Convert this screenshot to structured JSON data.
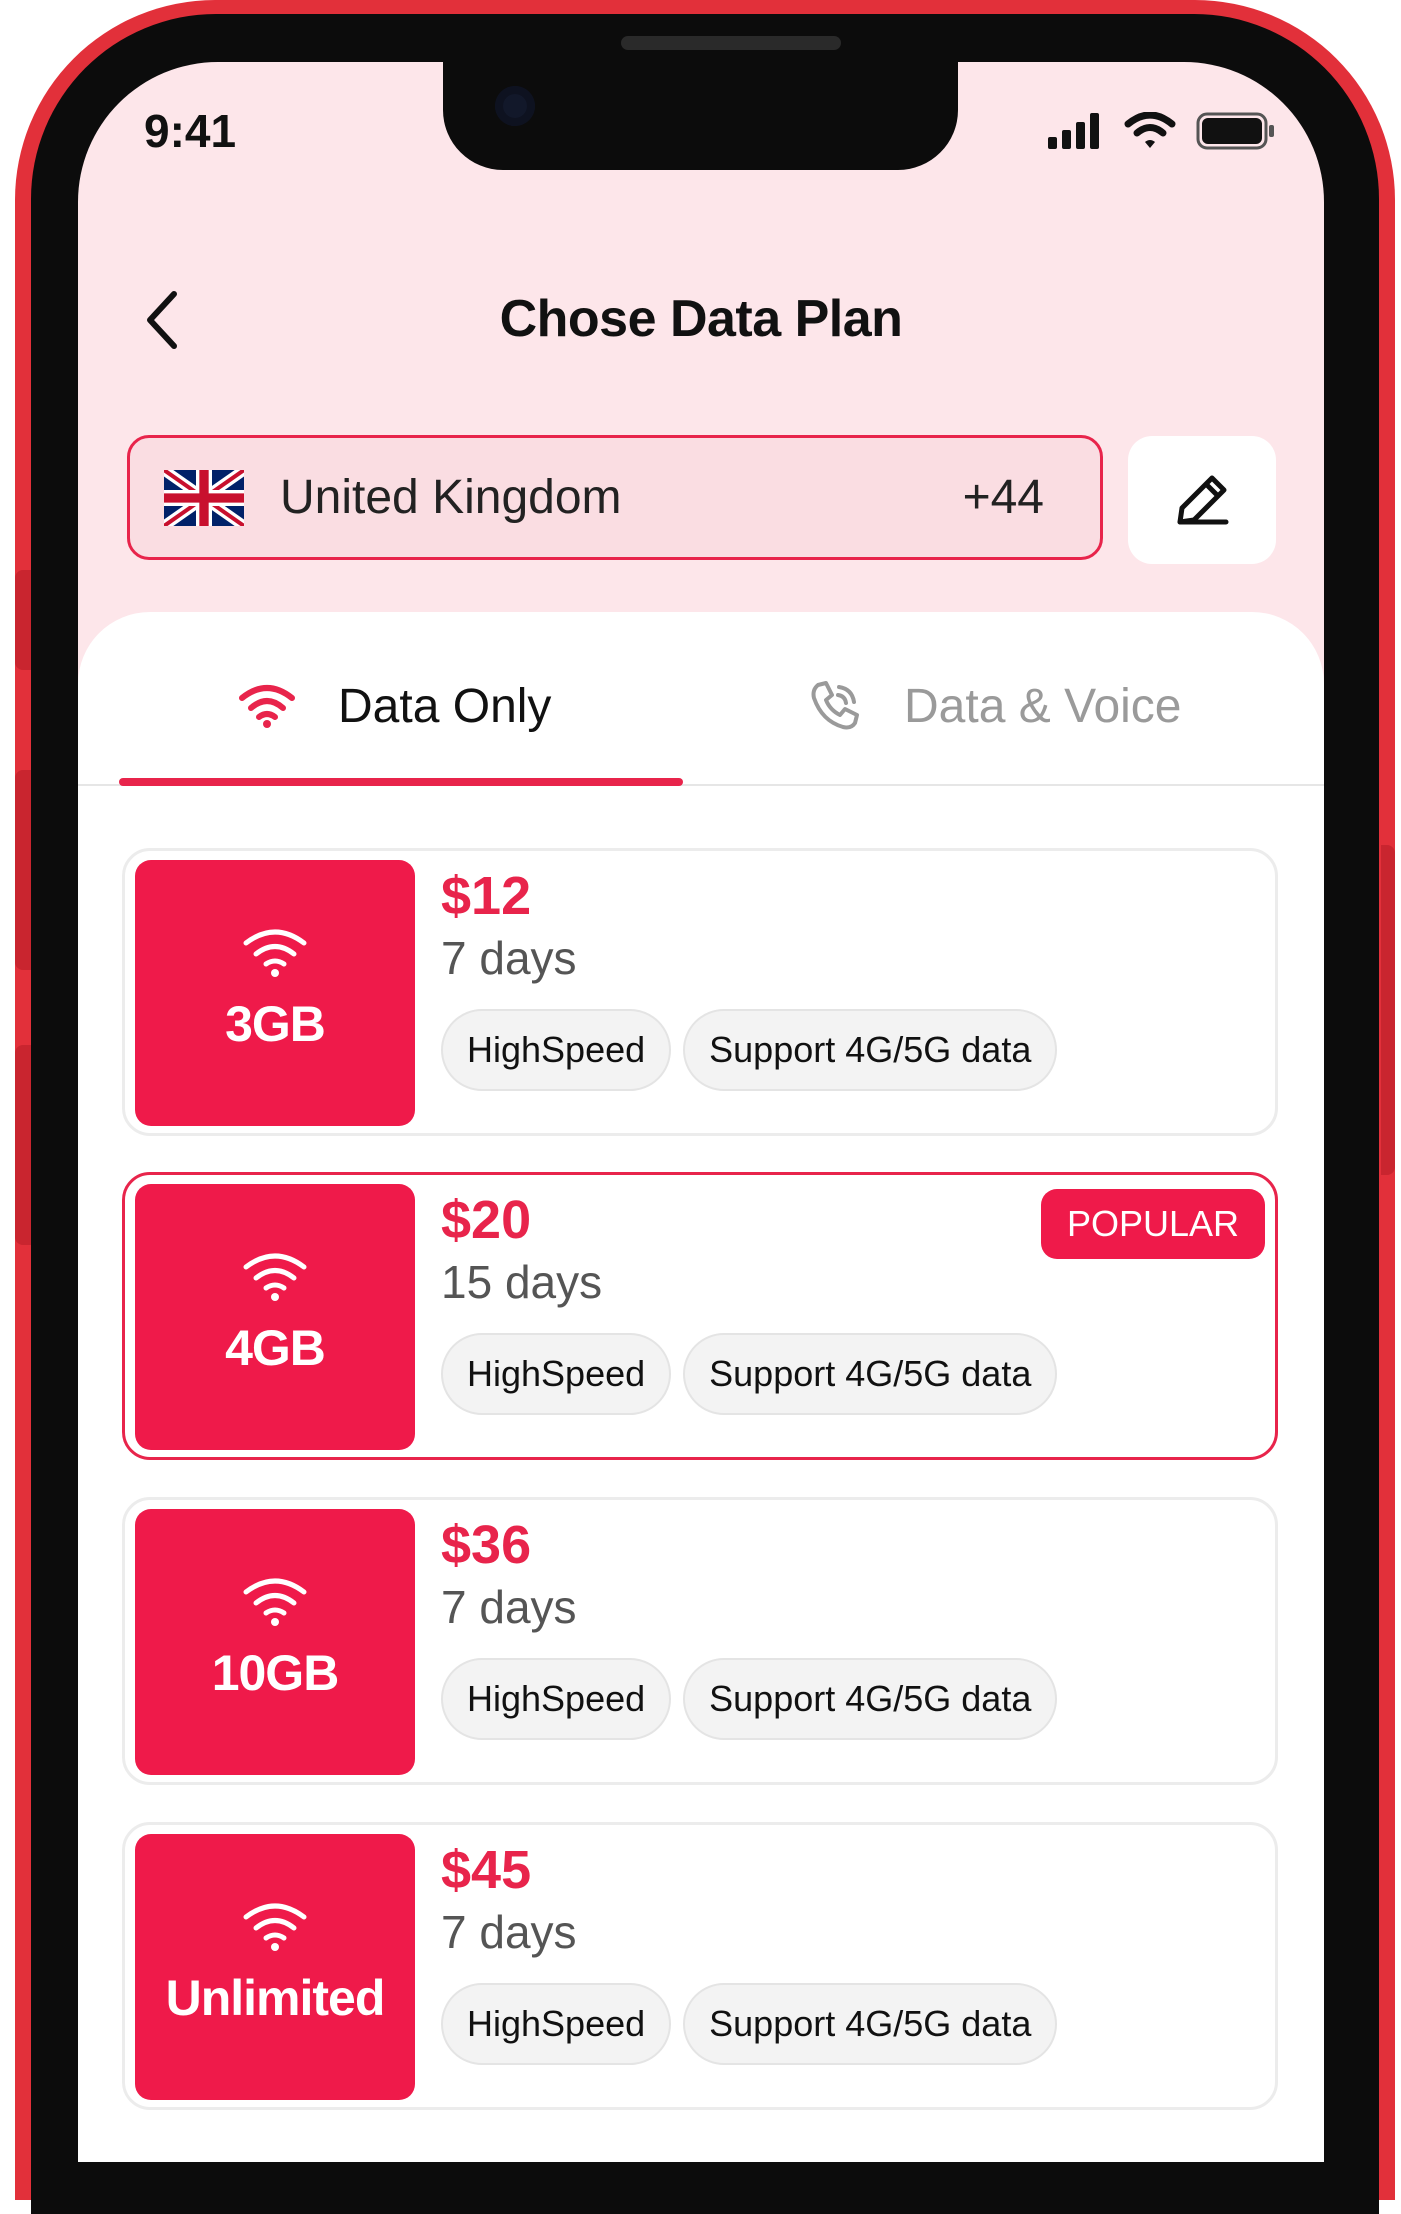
{
  "status_bar": {
    "time": "9:41"
  },
  "header": {
    "title": "Chose Data Plan"
  },
  "country": {
    "name": "United Kingdom",
    "code": "+44",
    "flag_icon": "uk-flag-icon"
  },
  "tabs": [
    {
      "label": "Data Only",
      "icon": "wifi-icon",
      "active": true
    },
    {
      "label": "Data & Voice",
      "icon": "phone-icon",
      "active": false
    }
  ],
  "plans": [
    {
      "amount": "3GB",
      "price": "$12",
      "duration": "7 days",
      "features": [
        "HighSpeed",
        "Support 4G/5G data"
      ],
      "badge": "",
      "selected": false
    },
    {
      "amount": "4GB",
      "price": "$20",
      "duration": "15 days",
      "features": [
        "HighSpeed",
        "Support 4G/5G data"
      ],
      "badge": "POPULAR",
      "selected": true
    },
    {
      "amount": "10GB",
      "price": "$36",
      "duration": "7 days",
      "features": [
        "HighSpeed",
        "Support 4G/5G data"
      ],
      "badge": "",
      "selected": false
    },
    {
      "amount": "Unlimited",
      "price": "$45",
      "duration": "7 days",
      "features": [
        "HighSpeed",
        "Support 4G/5G data"
      ],
      "badge": "",
      "selected": false
    }
  ],
  "colors": {
    "accent": "#e8244b",
    "tile": "#ef1a4a",
    "header_bg": "#fde6ea",
    "frame": "#e2303a"
  }
}
